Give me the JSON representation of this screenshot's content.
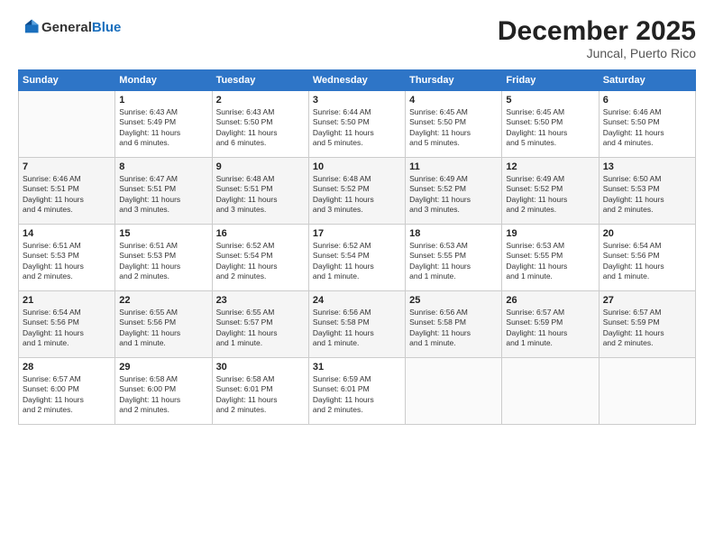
{
  "logo": {
    "general": "General",
    "blue": "Blue"
  },
  "header": {
    "title": "December 2025",
    "subtitle": "Juncal, Puerto Rico"
  },
  "weekdays": [
    "Sunday",
    "Monday",
    "Tuesday",
    "Wednesday",
    "Thursday",
    "Friday",
    "Saturday"
  ],
  "weeks": [
    [
      {
        "day": "",
        "detail": ""
      },
      {
        "day": "1",
        "detail": "Sunrise: 6:43 AM\nSunset: 5:49 PM\nDaylight: 11 hours\nand 6 minutes."
      },
      {
        "day": "2",
        "detail": "Sunrise: 6:43 AM\nSunset: 5:50 PM\nDaylight: 11 hours\nand 6 minutes."
      },
      {
        "day": "3",
        "detail": "Sunrise: 6:44 AM\nSunset: 5:50 PM\nDaylight: 11 hours\nand 5 minutes."
      },
      {
        "day": "4",
        "detail": "Sunrise: 6:45 AM\nSunset: 5:50 PM\nDaylight: 11 hours\nand 5 minutes."
      },
      {
        "day": "5",
        "detail": "Sunrise: 6:45 AM\nSunset: 5:50 PM\nDaylight: 11 hours\nand 5 minutes."
      },
      {
        "day": "6",
        "detail": "Sunrise: 6:46 AM\nSunset: 5:50 PM\nDaylight: 11 hours\nand 4 minutes."
      }
    ],
    [
      {
        "day": "7",
        "detail": "Sunrise: 6:46 AM\nSunset: 5:51 PM\nDaylight: 11 hours\nand 4 minutes."
      },
      {
        "day": "8",
        "detail": "Sunrise: 6:47 AM\nSunset: 5:51 PM\nDaylight: 11 hours\nand 3 minutes."
      },
      {
        "day": "9",
        "detail": "Sunrise: 6:48 AM\nSunset: 5:51 PM\nDaylight: 11 hours\nand 3 minutes."
      },
      {
        "day": "10",
        "detail": "Sunrise: 6:48 AM\nSunset: 5:52 PM\nDaylight: 11 hours\nand 3 minutes."
      },
      {
        "day": "11",
        "detail": "Sunrise: 6:49 AM\nSunset: 5:52 PM\nDaylight: 11 hours\nand 3 minutes."
      },
      {
        "day": "12",
        "detail": "Sunrise: 6:49 AM\nSunset: 5:52 PM\nDaylight: 11 hours\nand 2 minutes."
      },
      {
        "day": "13",
        "detail": "Sunrise: 6:50 AM\nSunset: 5:53 PM\nDaylight: 11 hours\nand 2 minutes."
      }
    ],
    [
      {
        "day": "14",
        "detail": "Sunrise: 6:51 AM\nSunset: 5:53 PM\nDaylight: 11 hours\nand 2 minutes."
      },
      {
        "day": "15",
        "detail": "Sunrise: 6:51 AM\nSunset: 5:53 PM\nDaylight: 11 hours\nand 2 minutes."
      },
      {
        "day": "16",
        "detail": "Sunrise: 6:52 AM\nSunset: 5:54 PM\nDaylight: 11 hours\nand 2 minutes."
      },
      {
        "day": "17",
        "detail": "Sunrise: 6:52 AM\nSunset: 5:54 PM\nDaylight: 11 hours\nand 1 minute."
      },
      {
        "day": "18",
        "detail": "Sunrise: 6:53 AM\nSunset: 5:55 PM\nDaylight: 11 hours\nand 1 minute."
      },
      {
        "day": "19",
        "detail": "Sunrise: 6:53 AM\nSunset: 5:55 PM\nDaylight: 11 hours\nand 1 minute."
      },
      {
        "day": "20",
        "detail": "Sunrise: 6:54 AM\nSunset: 5:56 PM\nDaylight: 11 hours\nand 1 minute."
      }
    ],
    [
      {
        "day": "21",
        "detail": "Sunrise: 6:54 AM\nSunset: 5:56 PM\nDaylight: 11 hours\nand 1 minute."
      },
      {
        "day": "22",
        "detail": "Sunrise: 6:55 AM\nSunset: 5:56 PM\nDaylight: 11 hours\nand 1 minute."
      },
      {
        "day": "23",
        "detail": "Sunrise: 6:55 AM\nSunset: 5:57 PM\nDaylight: 11 hours\nand 1 minute."
      },
      {
        "day": "24",
        "detail": "Sunrise: 6:56 AM\nSunset: 5:58 PM\nDaylight: 11 hours\nand 1 minute."
      },
      {
        "day": "25",
        "detail": "Sunrise: 6:56 AM\nSunset: 5:58 PM\nDaylight: 11 hours\nand 1 minute."
      },
      {
        "day": "26",
        "detail": "Sunrise: 6:57 AM\nSunset: 5:59 PM\nDaylight: 11 hours\nand 1 minute."
      },
      {
        "day": "27",
        "detail": "Sunrise: 6:57 AM\nSunset: 5:59 PM\nDaylight: 11 hours\nand 2 minutes."
      }
    ],
    [
      {
        "day": "28",
        "detail": "Sunrise: 6:57 AM\nSunset: 6:00 PM\nDaylight: 11 hours\nand 2 minutes."
      },
      {
        "day": "29",
        "detail": "Sunrise: 6:58 AM\nSunset: 6:00 PM\nDaylight: 11 hours\nand 2 minutes."
      },
      {
        "day": "30",
        "detail": "Sunrise: 6:58 AM\nSunset: 6:01 PM\nDaylight: 11 hours\nand 2 minutes."
      },
      {
        "day": "31",
        "detail": "Sunrise: 6:59 AM\nSunset: 6:01 PM\nDaylight: 11 hours\nand 2 minutes."
      },
      {
        "day": "",
        "detail": ""
      },
      {
        "day": "",
        "detail": ""
      },
      {
        "day": "",
        "detail": ""
      }
    ]
  ]
}
